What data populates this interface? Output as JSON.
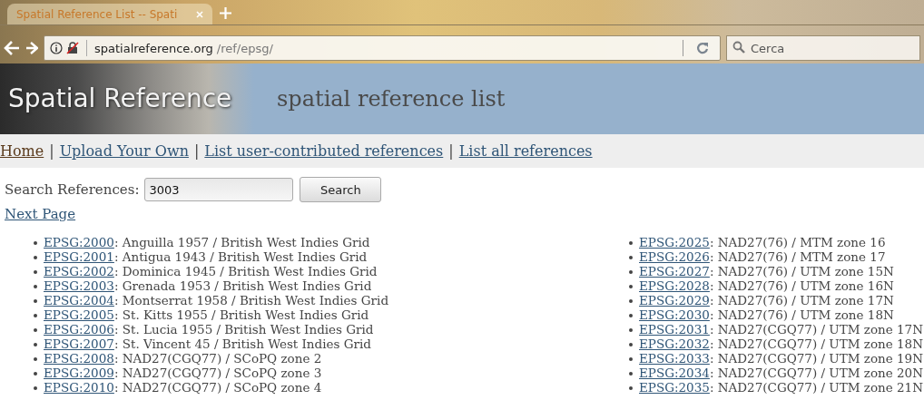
{
  "browser": {
    "tab_title": "Spatial Reference List -- Spati",
    "url_host": "spatialreference.org",
    "url_path": "/ref/epsg/",
    "search_placeholder": "Cerca"
  },
  "header": {
    "logo": "Spatial Reference",
    "title": "spatial reference list"
  },
  "nav": [
    {
      "kind": "link",
      "text": "Home",
      "visited": true
    },
    {
      "kind": "separator",
      "text": "|"
    },
    {
      "kind": "link",
      "text": "Upload Your Own",
      "visited": false
    },
    {
      "kind": "separator",
      "text": "|"
    },
    {
      "kind": "link",
      "text": "List user-contributed references",
      "visited": false
    },
    {
      "kind": "separator",
      "text": "|"
    },
    {
      "kind": "link",
      "text": "List all references",
      "visited": false
    }
  ],
  "search": {
    "label": "Search References:",
    "value": "3003",
    "button": "Search"
  },
  "next_page": "Next Page",
  "columns": [
    [
      {
        "code": "EPSG:2000",
        "name": ": Anguilla 1957 / British West Indies Grid"
      },
      {
        "code": "EPSG:2001",
        "name": ": Antigua 1943 / British West Indies Grid"
      },
      {
        "code": "EPSG:2002",
        "name": ": Dominica 1945 / British West Indies Grid"
      },
      {
        "code": "EPSG:2003",
        "name": ": Grenada 1953 / British West Indies Grid"
      },
      {
        "code": "EPSG:2004",
        "name": ": Montserrat 1958 / British West Indies Grid"
      },
      {
        "code": "EPSG:2005",
        "name": ": St. Kitts 1955 / British West Indies Grid"
      },
      {
        "code": "EPSG:2006",
        "name": ": St. Lucia 1955 / British West Indies Grid"
      },
      {
        "code": "EPSG:2007",
        "name": ": St. Vincent 45 / British West Indies Grid"
      },
      {
        "code": "EPSG:2008",
        "name": ": NAD27(CGQ77) / SCoPQ zone 2"
      },
      {
        "code": "EPSG:2009",
        "name": ": NAD27(CGQ77) / SCoPQ zone 3"
      },
      {
        "code": "EPSG:2010",
        "name": ": NAD27(CGQ77) / SCoPQ zone 4"
      }
    ],
    [
      {
        "code": "EPSG:2025",
        "name": ": NAD27(76) / MTM zone 16"
      },
      {
        "code": "EPSG:2026",
        "name": ": NAD27(76) / MTM zone 17"
      },
      {
        "code": "EPSG:2027",
        "name": ": NAD27(76) / UTM zone 15N"
      },
      {
        "code": "EPSG:2028",
        "name": ": NAD27(76) / UTM zone 16N"
      },
      {
        "code": "EPSG:2029",
        "name": ": NAD27(76) / UTM zone 17N"
      },
      {
        "code": "EPSG:2030",
        "name": ": NAD27(76) / UTM zone 18N"
      },
      {
        "code": "EPSG:2031",
        "name": ": NAD27(CGQ77) / UTM zone 17N"
      },
      {
        "code": "EPSG:2032",
        "name": ": NAD27(CGQ77) / UTM zone 18N"
      },
      {
        "code": "EPSG:2033",
        "name": ": NAD27(CGQ77) / UTM zone 19N"
      },
      {
        "code": "EPSG:2034",
        "name": ": NAD27(CGQ77) / UTM zone 20N"
      },
      {
        "code": "EPSG:2035",
        "name": ": NAD27(CGQ77) / UTM zone 21N"
      }
    ]
  ]
}
